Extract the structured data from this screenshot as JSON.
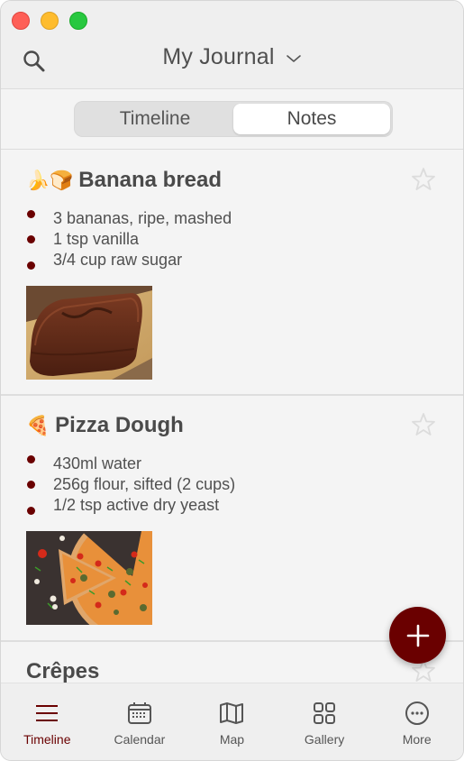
{
  "header": {
    "title": "My Journal",
    "search_icon": "search-icon",
    "dropdown_icon": "chevron-down-icon"
  },
  "segment": {
    "options": [
      {
        "label": "Timeline",
        "active": false
      },
      {
        "label": "Notes",
        "active": true
      }
    ]
  },
  "notes": [
    {
      "emoji": "🍌🍞",
      "title": "Banana bread",
      "starred": false,
      "ingredients": [
        "3 bananas, ripe, mashed",
        "1 tsp vanilla",
        "3/4 cup raw sugar"
      ],
      "image": "banana-bread-photo"
    },
    {
      "emoji": "🍕",
      "title": "Pizza Dough",
      "starred": false,
      "ingredients": [
        "430ml water",
        "256g flour, sifted (2 cups)",
        "1/2 tsp active dry yeast"
      ],
      "image": "pizza-photo"
    },
    {
      "emoji": "",
      "title": "Crêpes",
      "starred": false
    }
  ],
  "fab": {
    "icon": "plus-icon"
  },
  "tabbar": {
    "items": [
      {
        "label": "Timeline",
        "icon": "list-icon",
        "active": true
      },
      {
        "label": "Calendar",
        "icon": "calendar-icon",
        "active": false
      },
      {
        "label": "Map",
        "icon": "map-icon",
        "active": false
      },
      {
        "label": "Gallery",
        "icon": "grid-icon",
        "active": false
      },
      {
        "label": "More",
        "icon": "more-icon",
        "active": false
      }
    ]
  },
  "colors": {
    "accent": "#6a0000",
    "background": "#f4f4f4",
    "header_bg": "#efefef",
    "star": "#dddddd"
  }
}
